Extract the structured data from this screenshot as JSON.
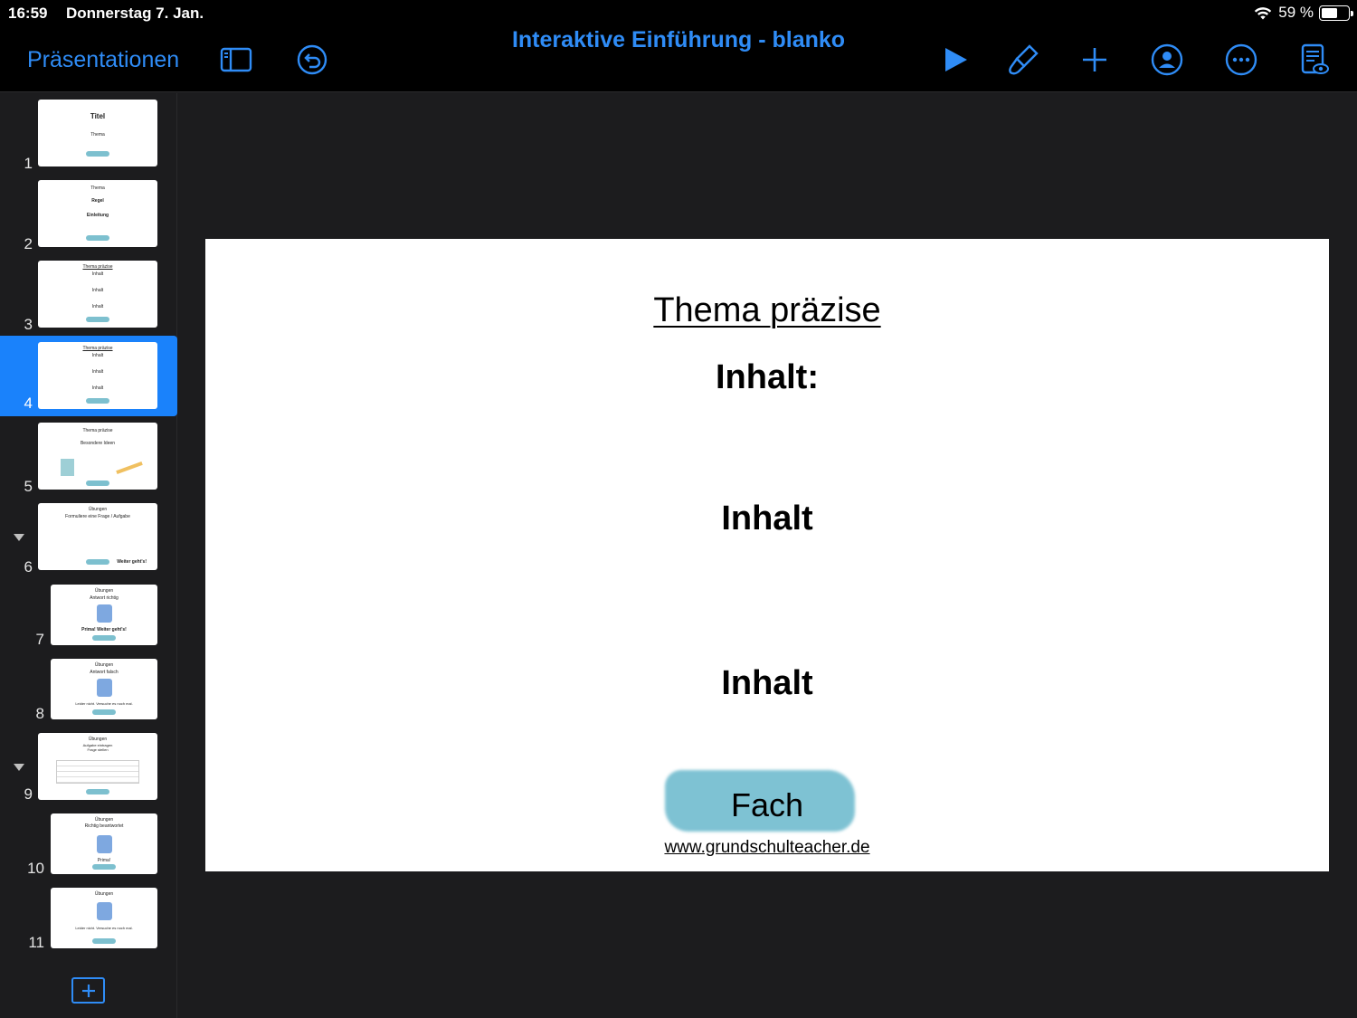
{
  "status_bar": {
    "time": "16:59",
    "date": "Donnerstag 7. Jan.",
    "battery": "59 %",
    "battery_level": 0.59
  },
  "toolbar": {
    "back_label": "Präsentationen",
    "title": "Interaktive Einführung - blanko",
    "icons": [
      "sidebar-icon",
      "undo-icon",
      "play-icon",
      "format-brush-icon",
      "add-icon",
      "collaborate-icon",
      "more-icon",
      "presenter-notes-icon"
    ],
    "accent_color": "#2f8cf6"
  },
  "slide_navigator": {
    "selected_index": 4,
    "slides": [
      {
        "num": "1",
        "thumb_lines": [
          "Titel",
          "Thema"
        ]
      },
      {
        "num": "2",
        "thumb_lines": [
          "Thema",
          "Regel",
          "Einleitung"
        ]
      },
      {
        "num": "3",
        "thumb_lines": [
          "Thema präzise",
          "Inhalt",
          "Inhalt",
          "Inhalt"
        ]
      },
      {
        "num": "4",
        "thumb_lines": [
          "Thema präzise",
          "Inhalt",
          "Inhalt",
          "Inhalt"
        ]
      },
      {
        "num": "5",
        "thumb_lines": [
          "Thema präzise",
          "Besondere Ideen"
        ]
      },
      {
        "num": "6",
        "thumb_lines": [
          "Übungen",
          "Formuliere eine Frage / Aufgabe",
          "Weiter geht's!"
        ]
      },
      {
        "num": "7",
        "thumb_lines": [
          "Übungen",
          "Antwort richtig",
          "Prima! Weiter geht's!"
        ]
      },
      {
        "num": "8",
        "thumb_lines": [
          "Übungen",
          "Antwort falsch",
          "Leider nicht. Versuche es noch mal."
        ]
      },
      {
        "num": "9",
        "thumb_lines": [
          "Übungen",
          "Aufgabe eintragen",
          "Frage stellen"
        ]
      },
      {
        "num": "10",
        "thumb_lines": [
          "Übungen",
          "Richtig beantwortet",
          "Prima!"
        ]
      },
      {
        "num": "11",
        "thumb_lines": [
          "Übungen",
          "Leider nicht. Versuche es noch mal."
        ]
      }
    ]
  },
  "slide": {
    "title": "Thema präzise",
    "heading": "Inhalt:",
    "content_1": "Inhalt",
    "content_2": "Inhalt",
    "badge": "Fach",
    "url": "www.grundschulteacher.de",
    "badge_color": "#78bfd1"
  }
}
